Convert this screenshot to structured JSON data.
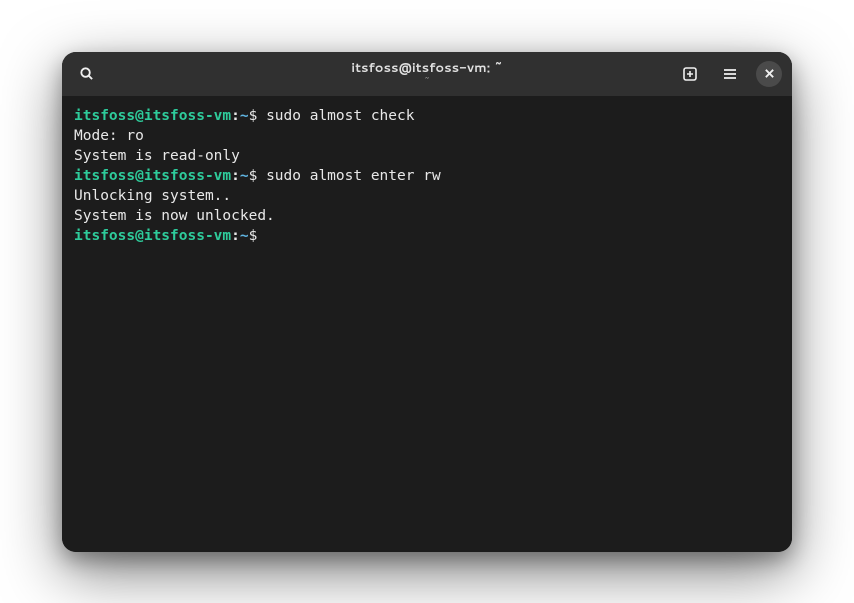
{
  "titlebar": {
    "title": "itsfoss@itsfoss-vm: ~",
    "subtitle": "~"
  },
  "prompt": {
    "user_host": "itsfoss@itsfoss-vm",
    "colon": ":",
    "path": "~",
    "symbol": "$"
  },
  "lines": {
    "cmd1": " sudo almost check",
    "out1": "Mode: ro",
    "out2": "System is read-only",
    "cmd2": " sudo almost enter rw",
    "out3": "Unlocking system..",
    "out4": "System is now unlocked.",
    "cmd3": " "
  },
  "icons": {
    "search": "search-icon",
    "new_tab": "new-tab-icon",
    "menu": "hamburger-menu-icon",
    "close": "close-icon"
  }
}
